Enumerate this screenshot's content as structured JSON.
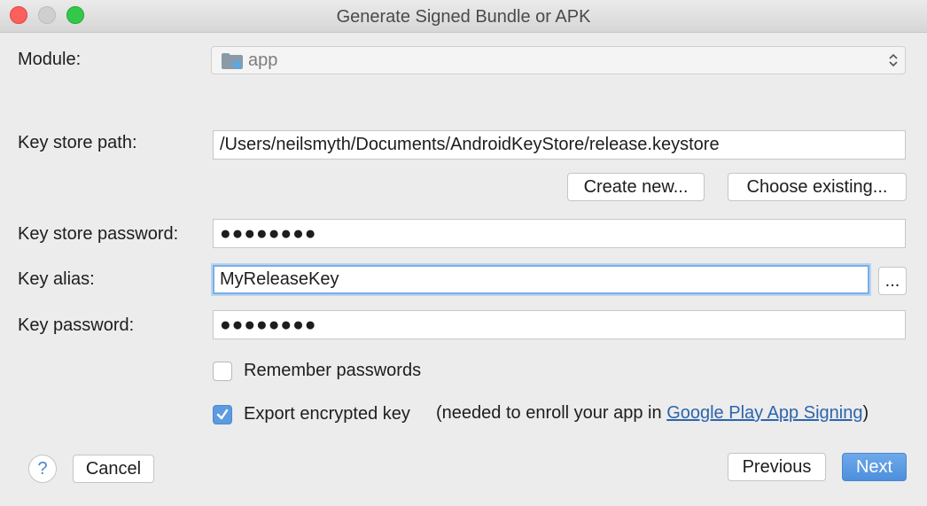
{
  "window": {
    "title": "Generate Signed Bundle or APK"
  },
  "module": {
    "label": "Module:",
    "value": "app"
  },
  "keystore": {
    "path_label": "Key store path:",
    "path_value": "/Users/neilsmyth/Documents/AndroidKeyStore/release.keystore",
    "create_new_label": "Create new...",
    "choose_existing_label": "Choose existing...",
    "password_label": "Key store password:",
    "password_value": "●●●●●●●●"
  },
  "key": {
    "alias_label": "Key alias:",
    "alias_value": "MyReleaseKey",
    "browse_label": "...",
    "password_label": "Key password:",
    "password_value": "●●●●●●●●"
  },
  "options": {
    "remember_label": "Remember passwords",
    "remember_checked": false,
    "export_label": "Export encrypted key",
    "export_checked": true,
    "export_note_prefix": "(needed to enroll your app in ",
    "export_note_link": "Google Play App Signing",
    "export_note_suffix": ")"
  },
  "footer": {
    "help_label": "?",
    "cancel_label": "Cancel",
    "previous_label": "Previous",
    "next_label": "Next"
  },
  "colors": {
    "accent": "#4d8fdc",
    "link": "#2e64ad",
    "focus_ring": "#7aaee3"
  }
}
